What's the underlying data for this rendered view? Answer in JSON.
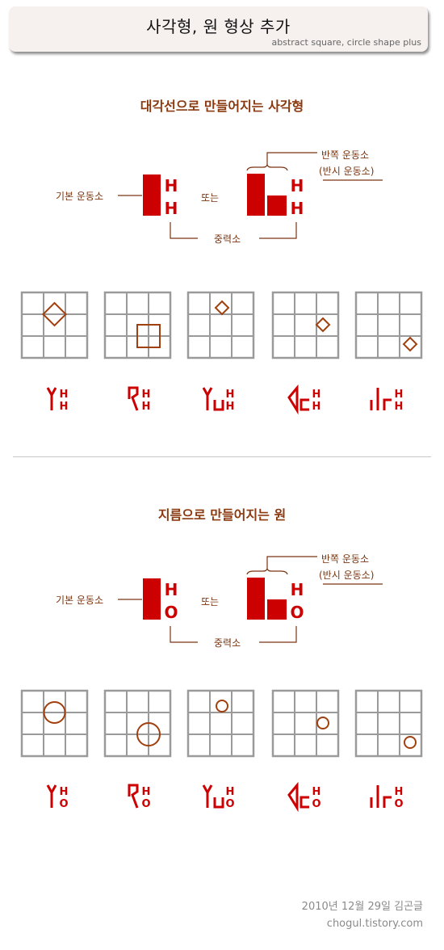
{
  "header": {
    "title": "사각형, 원 형상 추가",
    "subtitle": "abstract square, circle shape plus"
  },
  "colors": {
    "accent_red": "#cc0000",
    "shape_brown": "#a0400f",
    "label_brown": "#7a3510",
    "grid_gray": "#9a9a9a"
  },
  "sections": [
    {
      "title": "대각선으로 만들어지는 사각형",
      "labels": {
        "basic": "기본 운동소",
        "or": "또는",
        "half_line1": "반쪽 운동소",
        "half_line2": "(반시 운동소)",
        "gravity": "중력소"
      },
      "symbol_letters": [
        "H",
        "H"
      ],
      "grids": [
        {
          "shape": "diamond",
          "position": "center on line between top-middle and middle-middle",
          "size": "large"
        },
        {
          "shape": "square",
          "position": "centered on bottom-right junction of middle cell",
          "size": "large"
        },
        {
          "shape": "diamond",
          "position": "top-middle cell, lower-left",
          "size": "small"
        },
        {
          "shape": "diamond",
          "position": "middle-right cell, lower-left",
          "size": "small"
        },
        {
          "shape": "diamond",
          "position": "bottom-right cell, center",
          "size": "small"
        }
      ],
      "glyphs": [
        {
          "mark": "Y-fork",
          "letters": [
            "H",
            "H"
          ]
        },
        {
          "mark": "hook",
          "letters": [
            "H",
            "H"
          ]
        },
        {
          "mark": "Y-fork + cup",
          "letters": [
            "H",
            "H"
          ]
        },
        {
          "mark": "wedge + bracket",
          "letters": [
            "H",
            "H"
          ]
        },
        {
          "mark": "bars + gamma",
          "letters": [
            "H",
            "H"
          ]
        }
      ]
    },
    {
      "title": "지름으로 만들어지는 원",
      "labels": {
        "basic": "기본 운동소",
        "or": "또는",
        "half_line1": "반쪽 운동소",
        "half_line2": "(반시 운동소)",
        "gravity": "중력소"
      },
      "symbol_letters": [
        "H",
        "O"
      ],
      "grids": [
        {
          "shape": "circle",
          "position": "center on line between top-middle and middle-middle",
          "size": "large"
        },
        {
          "shape": "circle",
          "position": "centered on bottom-right junction of middle cell",
          "size": "large"
        },
        {
          "shape": "circle",
          "position": "top-middle cell, lower-left",
          "size": "small"
        },
        {
          "shape": "circle",
          "position": "middle-right cell, lower-left",
          "size": "small"
        },
        {
          "shape": "circle",
          "position": "bottom-right cell, center",
          "size": "small"
        }
      ],
      "glyphs": [
        {
          "mark": "Y-fork",
          "letters": [
            "H",
            "O"
          ]
        },
        {
          "mark": "hook",
          "letters": [
            "H",
            "O"
          ]
        },
        {
          "mark": "Y-fork + cup",
          "letters": [
            "H",
            "O"
          ]
        },
        {
          "mark": "wedge + bracket",
          "letters": [
            "H",
            "O"
          ]
        },
        {
          "mark": "bars + gamma",
          "letters": [
            "H",
            "O"
          ]
        }
      ]
    }
  ],
  "footer": {
    "date": "2010년 12월 29일 김곤글",
    "url": "chogul.tistory.com"
  }
}
